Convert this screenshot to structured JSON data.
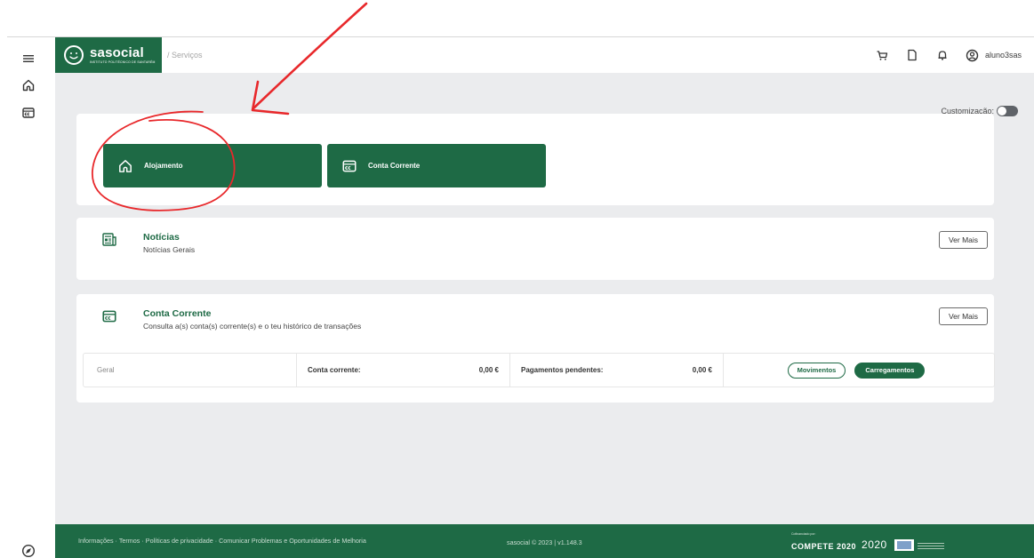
{
  "header": {
    "logo_name": "sasocial",
    "logo_subtitle": "INSTITUTO POLITÉCNICO DE SANTARÉM",
    "breadcrumb": "/ Serviços",
    "username": "aluno3sas",
    "icons": [
      "cart-icon",
      "document-icon",
      "bell-icon",
      "user-circle-icon"
    ]
  },
  "sidebar": {
    "icons": [
      "menu-icon",
      "home-icon",
      "wallet-icon",
      "compass-icon"
    ]
  },
  "customization": {
    "label": "Customização:",
    "enabled": false
  },
  "services": [
    {
      "label": "Alojamento",
      "icon": "home-icon"
    },
    {
      "label": "Conta Corrente",
      "icon": "wallet-icon"
    }
  ],
  "news": {
    "title": "Notícias",
    "subtitle": "Notícias Gerais",
    "button": "Ver Mais",
    "icon": "newspaper-icon"
  },
  "account": {
    "title": "Conta Corrente",
    "subtitle": "Consulta a(s) conta(s) corrente(s) e o teu histórico de transações",
    "button": "Ver Mais",
    "icon": "wallet-icon",
    "row": {
      "name": "Geral",
      "balance_label": "Conta corrente:",
      "balance_value": "0,00 €",
      "pending_label": "Pagamentos pendentes:",
      "pending_value": "0,00 €",
      "movements_button": "Movimentos",
      "topups_button": "Carregamentos"
    }
  },
  "footer": {
    "links": [
      "Informações",
      "Termos",
      "Políticas de privacidade",
      "Comunicar Problemas e Oportunidades de Melhoria"
    ],
    "separator": " · ",
    "copyright": "sasocial © 2023 | v1.148.3",
    "funding_small": "Cofinanciado por:",
    "compete": "COMPETE 2020",
    "portugal": "2020"
  },
  "colors": {
    "brand_green": "#1e6a45",
    "background_gray": "#ebecee",
    "annotation_red": "#e8282b"
  }
}
